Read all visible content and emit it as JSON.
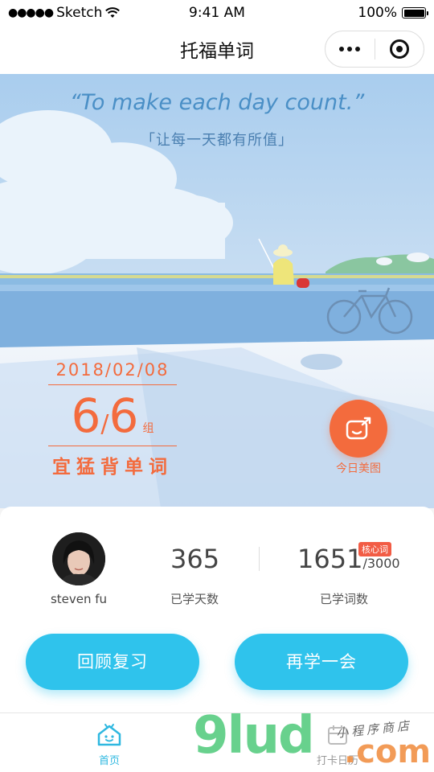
{
  "status_bar": {
    "carrier": "Sketch",
    "time": "9:41 AM",
    "battery": "100%"
  },
  "navbar": {
    "title": "托福单词"
  },
  "hero": {
    "quote": "“To make each day count.”",
    "quote_cn": "「让每一天都有所值」",
    "date": "2018/02/08",
    "done": "6",
    "total": "6",
    "unit": "组",
    "motto": "宜猛背单词",
    "today_label": "今日美图"
  },
  "profile": {
    "name": "steven fu"
  },
  "stats": {
    "days": "365",
    "days_label": "已学天数",
    "words": "1651",
    "words_total": "/3000",
    "words_label": "已学词数",
    "badge": "核心词"
  },
  "actions": {
    "review": "回顾复习",
    "learn_more": "再学一会"
  },
  "tabs": [
    {
      "label": "首页",
      "icon": "home-icon",
      "active": true
    },
    {
      "label": "打卡日历",
      "icon": "calendar-icon",
      "active": false
    }
  ],
  "watermark": {
    "brand": "9lud",
    "domain": ".com",
    "tagline": "小程序商店"
  },
  "colors": {
    "accent": "#f36b3d",
    "primary": "#2fc3ec",
    "tab_active": "#2fb8e0"
  }
}
